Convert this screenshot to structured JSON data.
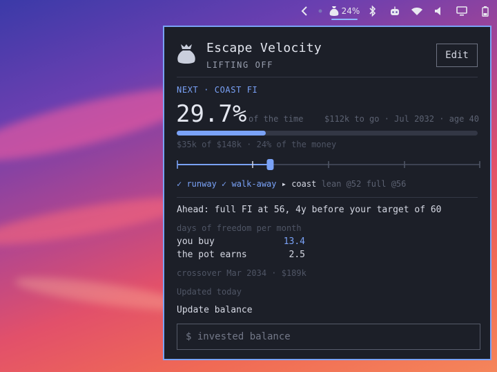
{
  "topbar": {
    "battery_percent": "24%"
  },
  "widget": {
    "title": "Escape Velocity",
    "subtitle": "LIFTING OFF",
    "edit_label": "Edit",
    "next_label": "NEXT · COAST FI",
    "percent": "29.7%",
    "percent_suffix": "of the time",
    "remaining": "$112k to go · Jul 2032 · age 40",
    "progress": 0.297,
    "money_line": "$35k of $148k · 24% of the money",
    "slider_value": 0.307,
    "milestones": {
      "runway": "✓ runway",
      "walkaway": "✓ walk-away",
      "current": "▸ coast",
      "extra": "lean @52 full @56"
    },
    "ahead": "Ahead: full FI at 56, 4y before your target of 60",
    "dof_label": "days of freedom per month",
    "rows": [
      {
        "label": "you buy",
        "value": "13.4"
      },
      {
        "label": "the pot earns",
        "value": "2.5"
      }
    ],
    "crossover": "crossover Mar 2034 · $189k",
    "updated": "Updated today",
    "update_label": "Update balance",
    "input_placeholder": "$ invested balance"
  },
  "colors": {
    "accent": "#7aa2f7",
    "panel_bg": "#1c1f28"
  }
}
